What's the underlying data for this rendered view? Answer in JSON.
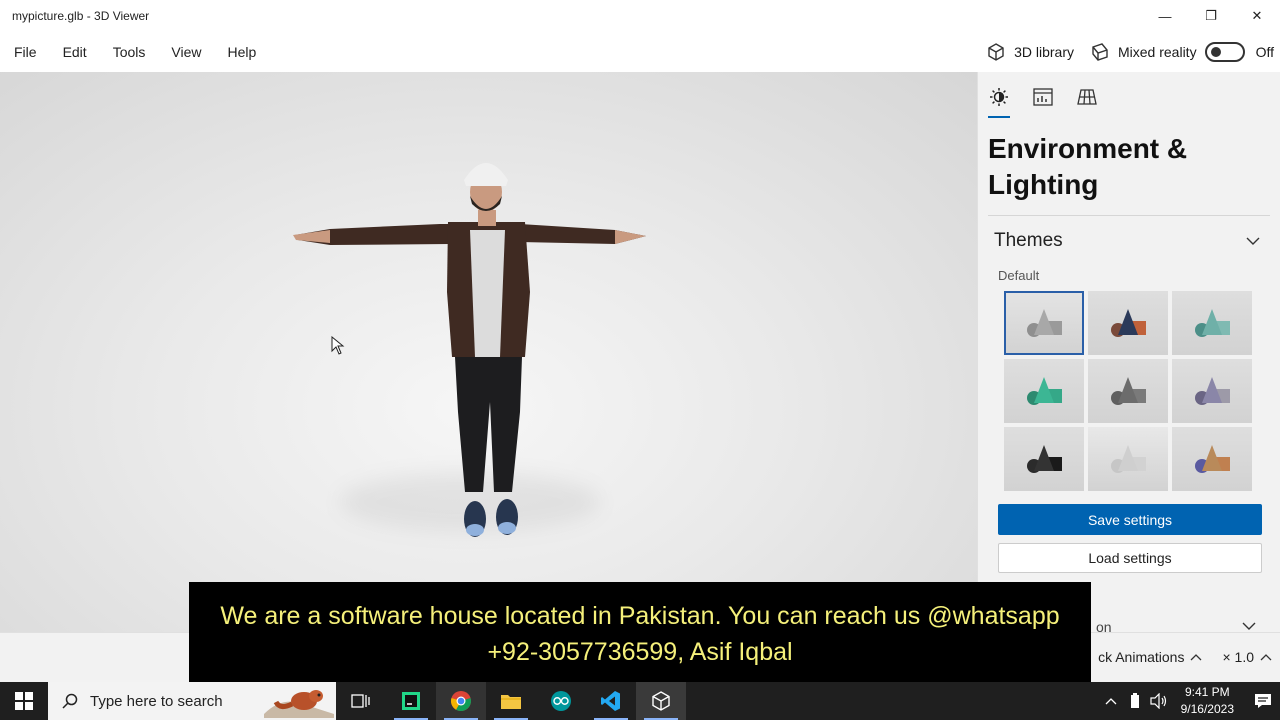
{
  "window": {
    "title": "mypicture.glb - 3D Viewer",
    "minimize": "—",
    "restore": "❐",
    "close": "✕"
  },
  "menu": {
    "items": [
      "File",
      "Edit",
      "Tools",
      "View",
      "Help"
    ],
    "library_label": "3D library",
    "mixed_reality_label": "Mixed reality",
    "mixed_reality_state": "Off"
  },
  "panel": {
    "heading": "Environment & Lighting",
    "themes_label": "Themes",
    "themes_sub": "Default",
    "themes": [
      {
        "bg": "#e4e4e4",
        "cone": "#a8a8a8",
        "box": "#9a9a9a",
        "ball": "#8f8f8f"
      },
      {
        "bg": "#dedede",
        "cone": "#2b3a5a",
        "box": "#c0613a",
        "ball": "#7a4a3a"
      },
      {
        "bg": "#dedede",
        "cone": "#6fb0a8",
        "box": "#7fbab2",
        "ball": "#4c8f88"
      },
      {
        "bg": "#dedede",
        "cone": "#3cb694",
        "box": "#35a888",
        "ball": "#2d8a70"
      },
      {
        "bg": "#dedede",
        "cone": "#6c6c6c",
        "box": "#7a7a7a",
        "ball": "#5f5f5f"
      },
      {
        "bg": "#dedede",
        "cone": "#8a86a8",
        "box": "#9d9aa8",
        "ball": "#6a6584"
      },
      {
        "bg": "#dedede",
        "cone": "#333333",
        "box": "#1a1a1a",
        "ball": "#2b2b2b"
      },
      {
        "bg": "#e8e8e8",
        "cone": "#cfcfcf",
        "box": "#d2d2d2",
        "ball": "#c6c6c6"
      },
      {
        "bg": "#dedede",
        "cone": "#b98a5a",
        "box": "#c08050",
        "ball": "#5a5aa0"
      }
    ],
    "save_label": "Save settings",
    "load_label": "Load settings",
    "collapsed_label": "on"
  },
  "animations": {
    "label": "ck Animations",
    "speed": "× 1.0"
  },
  "subtitle": {
    "line1": "We are a software house located in Pakistan. You can reach us @whatsapp",
    "line2": "+92-3057736599, Asif Iqbal"
  },
  "taskbar": {
    "search_placeholder": "Type here to search",
    "time": "9:41 PM",
    "date": "9/16/2023"
  },
  "colors": {
    "accent": "#0063b1",
    "subtitle_text": "#f5f07a",
    "taskbar_bg": "#1f1f1f"
  }
}
